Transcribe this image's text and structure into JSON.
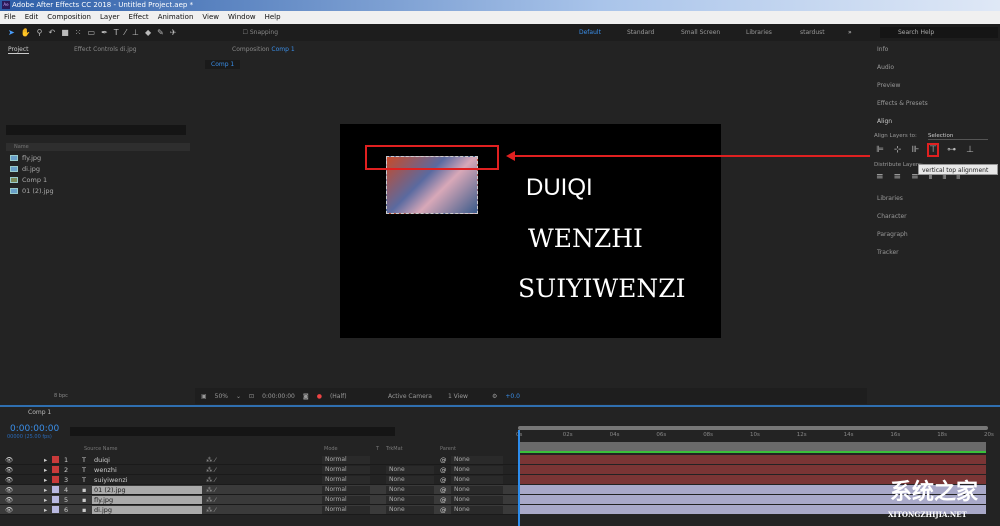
{
  "window": {
    "title": "Adobe After Effects CC 2018 - Untitled Project.aep *",
    "logo": "Ae"
  },
  "menu": [
    "File",
    "Edit",
    "Composition",
    "Layer",
    "Effect",
    "Animation",
    "View",
    "Window",
    "Help"
  ],
  "toolbar": {
    "snapping": "Snapping",
    "icons": [
      "selection-tool",
      "hand-tool",
      "zoom-tool",
      "rotate-tool",
      "camera-tool",
      "pan-behind-tool",
      "rectangle-tool",
      "pen-tool",
      "type-tool",
      "brush-tool",
      "clone-stamp-tool",
      "eraser-tool",
      "roto-brush-tool",
      "puppet-pin-tool"
    ]
  },
  "workspaces": {
    "items": [
      "Default",
      "Standard",
      "Small Screen",
      "Libraries",
      "stardust"
    ],
    "active": "Default",
    "more": "»"
  },
  "search_help": "Search Help",
  "project": {
    "tab": "Project",
    "effect_controls": "Effect Controls di.jpg",
    "name_header": "Name",
    "items": [
      {
        "name": "fly.jpg",
        "type": "image"
      },
      {
        "name": "di.jpg",
        "type": "image"
      },
      {
        "name": "Comp 1",
        "type": "comp"
      },
      {
        "name": "01 (2).jpg",
        "type": "image"
      }
    ],
    "bpc": "8 bpc"
  },
  "composition": {
    "tab_prefix": "Composition",
    "tab_name": "Comp 1",
    "sub_tab": "Comp 1",
    "texts": [
      "DUIQI",
      "WENZHI",
      "SUIYIWENZI"
    ]
  },
  "viewer": {
    "zoom": "50%",
    "time": "0:00:00:00",
    "resolution": "(Half)",
    "camera": "Active Camera",
    "views": "1 View",
    "exposure": "+0.0"
  },
  "right_panels": {
    "top": [
      "Info",
      "Audio",
      "Preview",
      "Effects & Presets"
    ],
    "align": {
      "title": "Align",
      "align_to_label": "Align Layers to:",
      "align_to_value": "Selection",
      "distribute_label": "Distribute Layers:",
      "tooltip": "vertical top alignment",
      "highlighted": "vertical-top-align"
    },
    "bottom": [
      "Libraries",
      "Character",
      "Paragraph",
      "Tracker"
    ]
  },
  "timeline": {
    "tab": "Comp 1",
    "timecode": "0:00:00:00",
    "frame_info": "00000 (25.00 fps)",
    "headers": {
      "source": "Source Name",
      "mode": "Mode",
      "t": "T",
      "trkmat": "TrkMat",
      "parent": "Parent"
    },
    "layers": [
      {
        "num": "1",
        "name": "duiqi",
        "kind": "text",
        "color": "#c83a3a",
        "mode": "Normal",
        "trkmat": "",
        "parent": "None"
      },
      {
        "num": "2",
        "name": "wenzhi",
        "kind": "text",
        "color": "#c83a3a",
        "mode": "Normal",
        "trkmat": "None",
        "parent": "None"
      },
      {
        "num": "3",
        "name": "suiyiwenzi",
        "kind": "text",
        "color": "#c83a3a",
        "mode": "Normal",
        "trkmat": "None",
        "parent": "None"
      },
      {
        "num": "4",
        "name": "01 (2).jpg",
        "kind": "image",
        "color": "#b8b8e0",
        "mode": "Normal",
        "trkmat": "None",
        "parent": "None"
      },
      {
        "num": "5",
        "name": "fly.jpg",
        "kind": "image",
        "color": "#b8b8e0",
        "mode": "Normal",
        "trkmat": "None",
        "parent": "None"
      },
      {
        "num": "6",
        "name": "di.jpg",
        "kind": "image",
        "color": "#b8b8e0",
        "mode": "Normal",
        "trkmat": "None",
        "parent": "None"
      }
    ],
    "ruler": [
      "0s",
      "02s",
      "04s",
      "06s",
      "08s",
      "10s",
      "12s",
      "14s",
      "16s",
      "18s",
      "20s"
    ]
  },
  "watermark": {
    "text": "系统之家",
    "url_text": "XITONGZHIJIA.NET"
  },
  "colors": {
    "accent": "#2d8ceb",
    "highlight": "#e02020",
    "text_bar": "#7a3535",
    "image_bar": "#a8a8c8"
  }
}
